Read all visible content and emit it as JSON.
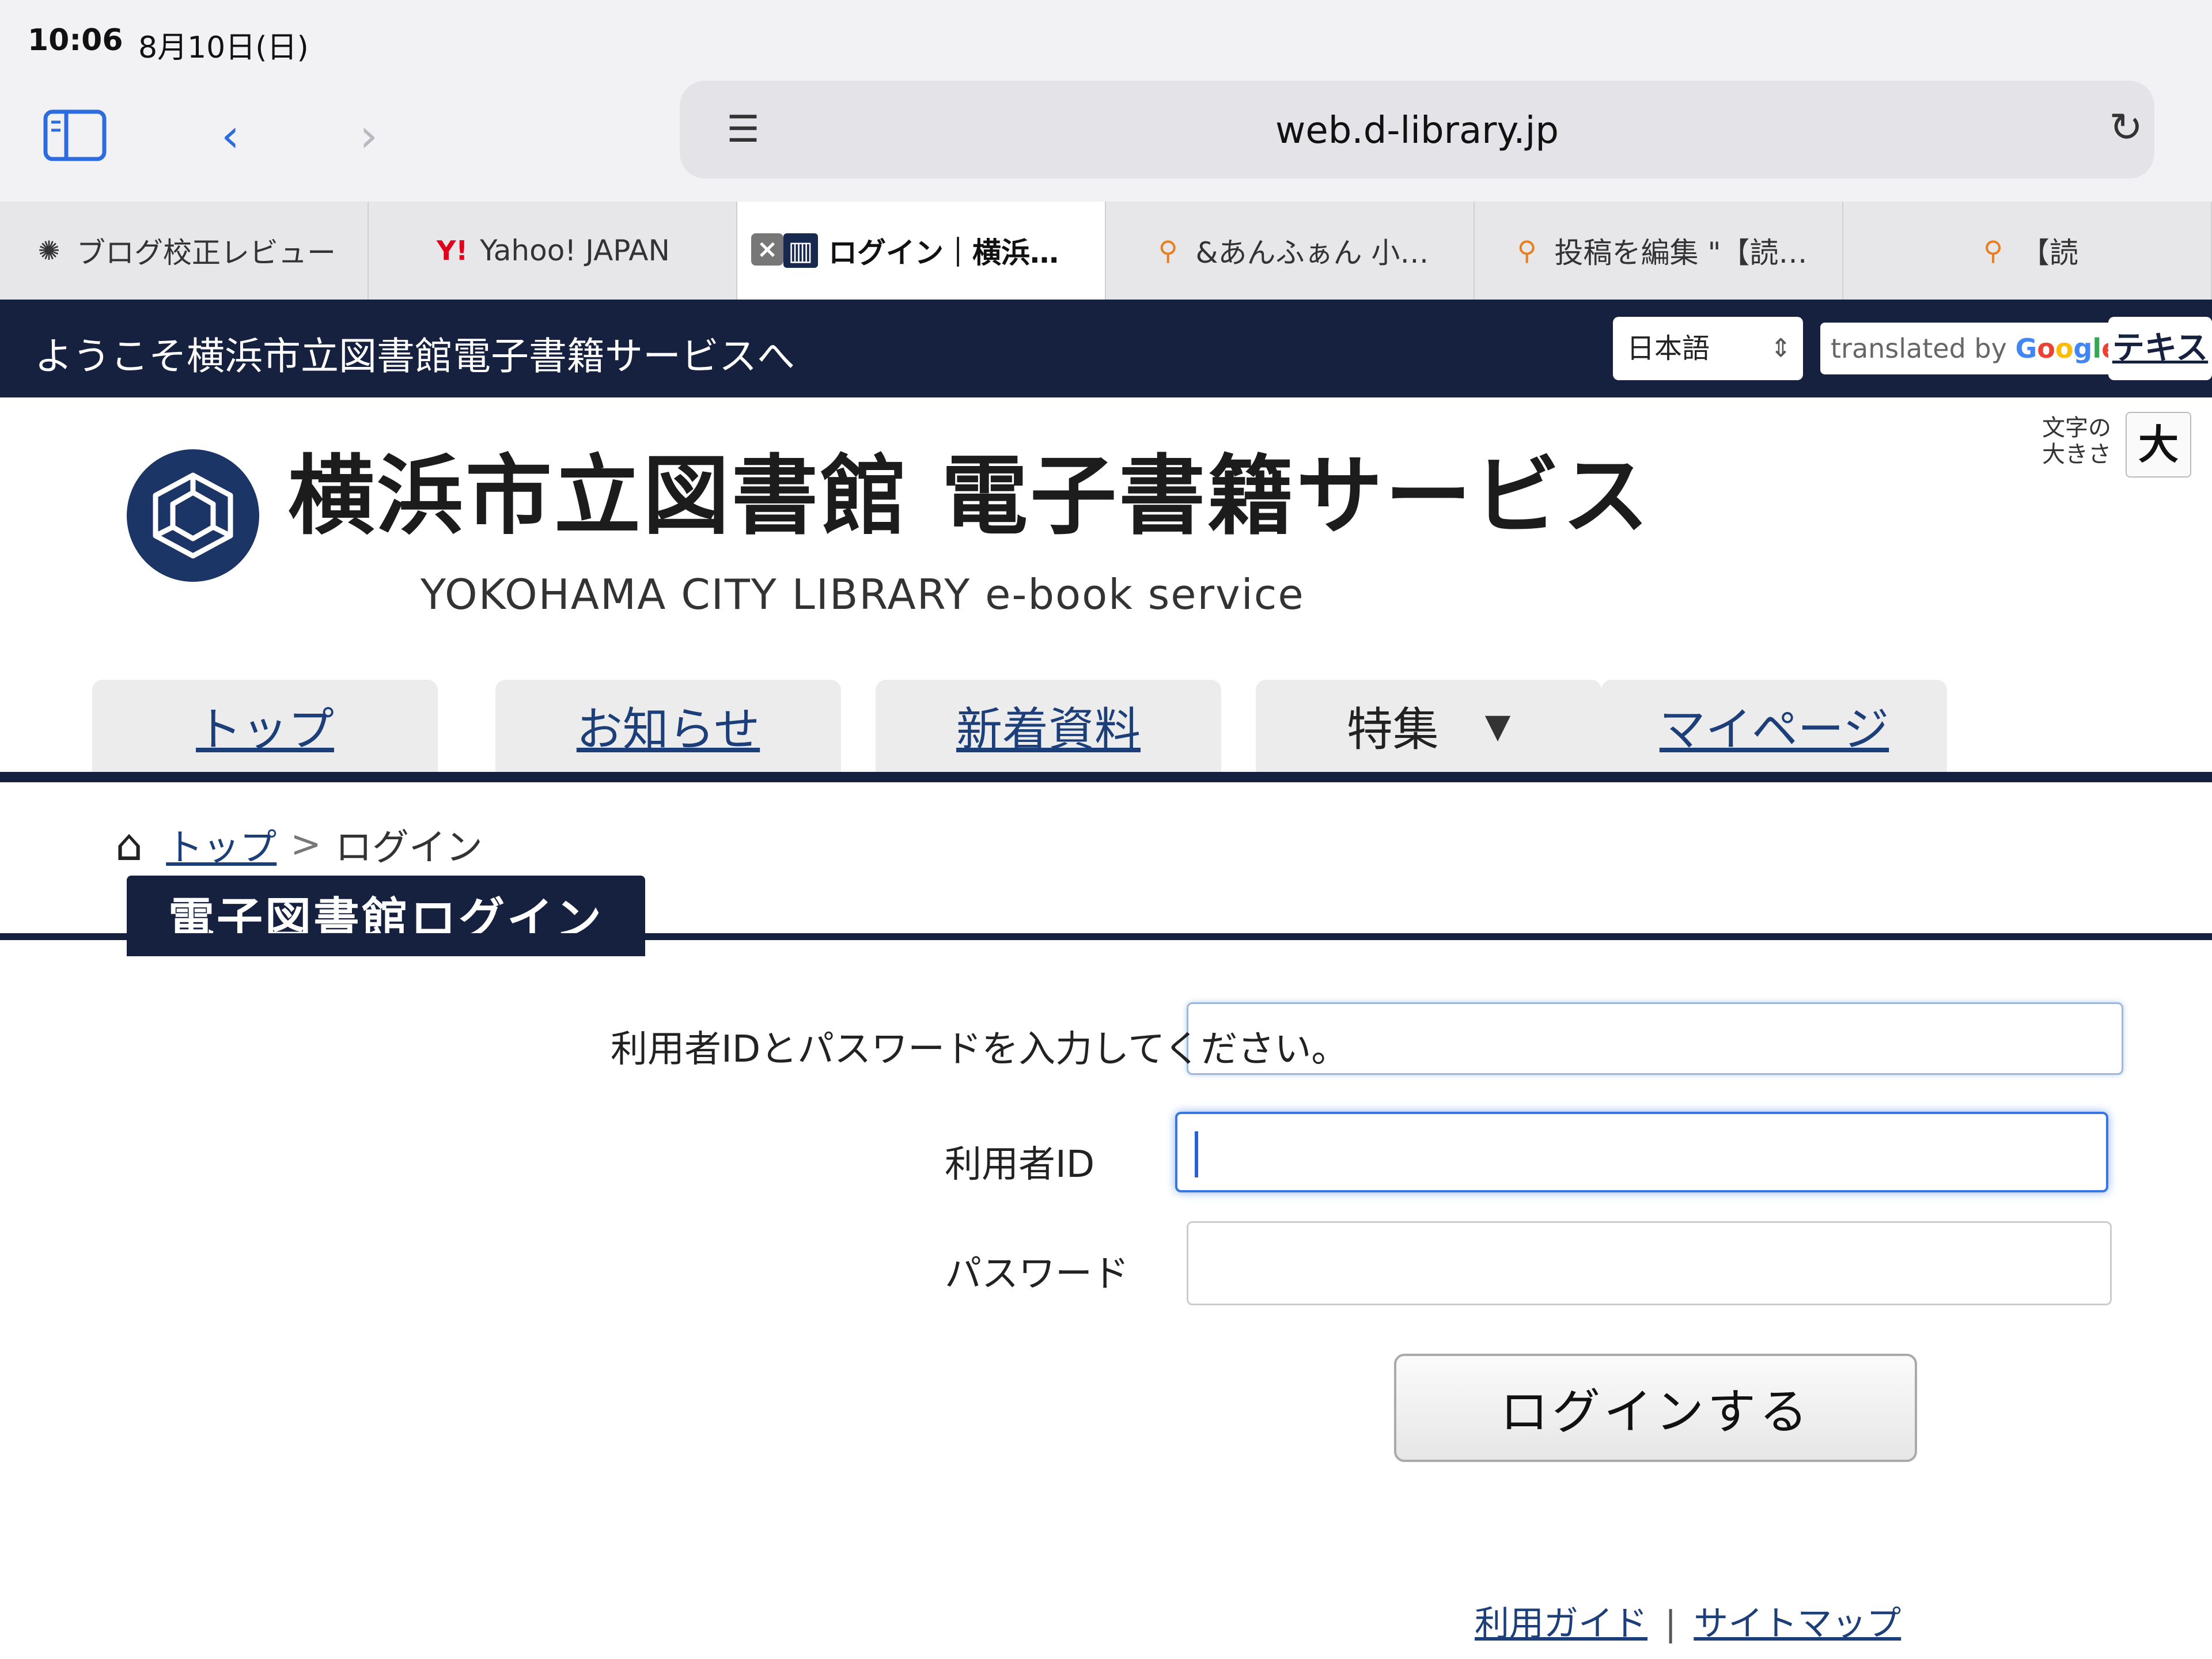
{
  "status": {
    "time": "10:06",
    "date": "8月10日(日)"
  },
  "browser": {
    "url": "web.d-library.jp"
  },
  "tabs": [
    {
      "label": "ブログ校正レビュー",
      "icon": "openai-icon"
    },
    {
      "label": "Yahoo! JAPAN",
      "icon": "yahoo-icon"
    },
    {
      "label": "ログイン｜横浜…",
      "icon": "book-icon",
      "active": true
    },
    {
      "label": "&あんふぁん 小…",
      "icon": "pin-icon"
    },
    {
      "label": "投稿を編集 \"【読…",
      "icon": "pin-icon"
    },
    {
      "label": "【読",
      "icon": "pin-icon"
    }
  ],
  "header": {
    "welcome": "ようこそ横浜市立図書館電子書籍サービスへ",
    "language": "日本語",
    "translated_by": "translated by",
    "google": "Google",
    "text_button": "テキス",
    "fontsize_label": "文字の大きさ",
    "fontsize_large": "大",
    "site_title": "横浜市立図書館 電子書籍サービス",
    "site_subtitle": "YOKOHAMA CITY LIBRARY e-book service"
  },
  "nav": {
    "top": "トップ",
    "news": "お知らせ",
    "new_items": "新着資料",
    "special": "特集",
    "mypage": "マイページ"
  },
  "breadcrumb": {
    "top": "トップ",
    "separator": ">",
    "current": "ログイン"
  },
  "login": {
    "heading": "電子図書館ログイン",
    "instruction": "利用者IDとパスワードを入力してください。",
    "id_label": "利用者ID",
    "password_label": "パスワード",
    "submit": "ログインする"
  },
  "footer": {
    "guide": "利用ガイド",
    "sitemap": "サイトマップ"
  },
  "colors": {
    "navy": "#16213f",
    "link": "#1c3f7a",
    "focus": "#3a76e0"
  }
}
